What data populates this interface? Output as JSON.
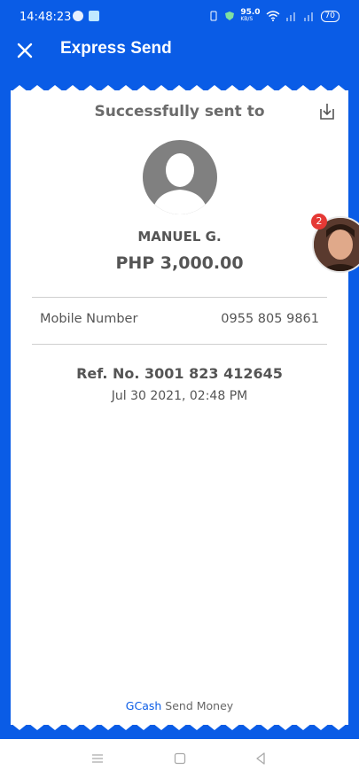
{
  "status_bar": {
    "time": "14:48:23",
    "net_speed": "95.0",
    "net_speed_unit": "KB/S",
    "battery": "70"
  },
  "header": {
    "title": "Express Send"
  },
  "receipt": {
    "sent_title": "Successfully sent to",
    "recipient_name": "MANUEL G.",
    "amount": "PHP 3,000.00",
    "mobile_label": "Mobile Number",
    "mobile_value": "0955 805 9861",
    "ref_no": "Ref. No. 3001 823 412645",
    "date": "Jul 30 2021, 02:48 PM",
    "footer_brand": "GCash",
    "footer_text": "Send Money"
  },
  "chat_head": {
    "badge_count": "2"
  },
  "colors": {
    "primary": "#0a5ce6",
    "badge": "#e53935"
  },
  "icons": {
    "close": "close-icon",
    "download": "download-icon",
    "avatar": "person-icon"
  }
}
